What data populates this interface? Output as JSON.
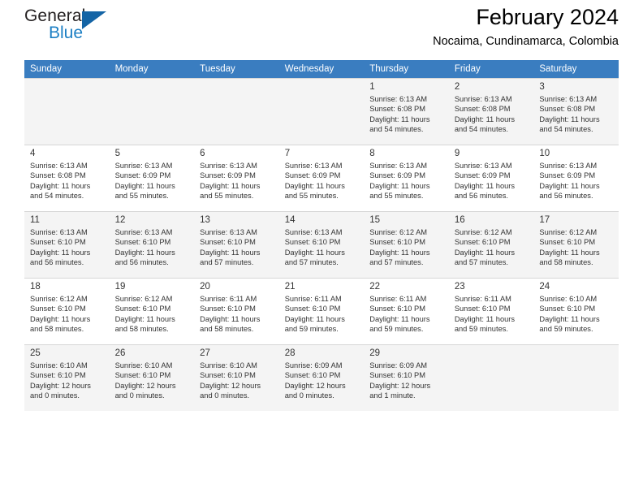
{
  "logo": {
    "word_top": "General",
    "word_bottom": "Blue",
    "triangle_color": "#1464a5",
    "blue_color": "#1c7fc4"
  },
  "header": {
    "title": "February 2024",
    "subtitle": "Nocaima, Cundinamarca, Colombia"
  },
  "theme": {
    "header_row_bg": "#3a7dc0",
    "header_row_text": "#ffffff",
    "shaded_row_bg": "#f4f4f4",
    "grid_line": "#d6d6d6",
    "text": "#333333"
  },
  "weekdays": [
    "Sunday",
    "Monday",
    "Tuesday",
    "Wednesday",
    "Thursday",
    "Friday",
    "Saturday"
  ],
  "labels": {
    "sunrise": "Sunrise:",
    "sunset": "Sunset:",
    "daylight": "Daylight:"
  },
  "weeks": [
    {
      "shaded": true,
      "days": [
        {
          "empty": true
        },
        {
          "empty": true
        },
        {
          "empty": true
        },
        {
          "empty": true
        },
        {
          "day": "1",
          "sunrise": "Sunrise: 6:13 AM",
          "sunset": "Sunset: 6:08 PM",
          "daylight_1": "Daylight: 11 hours",
          "daylight_2": "and 54 minutes."
        },
        {
          "day": "2",
          "sunrise": "Sunrise: 6:13 AM",
          "sunset": "Sunset: 6:08 PM",
          "daylight_1": "Daylight: 11 hours",
          "daylight_2": "and 54 minutes."
        },
        {
          "day": "3",
          "sunrise": "Sunrise: 6:13 AM",
          "sunset": "Sunset: 6:08 PM",
          "daylight_1": "Daylight: 11 hours",
          "daylight_2": "and 54 minutes."
        }
      ]
    },
    {
      "shaded": false,
      "days": [
        {
          "day": "4",
          "sunrise": "Sunrise: 6:13 AM",
          "sunset": "Sunset: 6:08 PM",
          "daylight_1": "Daylight: 11 hours",
          "daylight_2": "and 54 minutes."
        },
        {
          "day": "5",
          "sunrise": "Sunrise: 6:13 AM",
          "sunset": "Sunset: 6:09 PM",
          "daylight_1": "Daylight: 11 hours",
          "daylight_2": "and 55 minutes."
        },
        {
          "day": "6",
          "sunrise": "Sunrise: 6:13 AM",
          "sunset": "Sunset: 6:09 PM",
          "daylight_1": "Daylight: 11 hours",
          "daylight_2": "and 55 minutes."
        },
        {
          "day": "7",
          "sunrise": "Sunrise: 6:13 AM",
          "sunset": "Sunset: 6:09 PM",
          "daylight_1": "Daylight: 11 hours",
          "daylight_2": "and 55 minutes."
        },
        {
          "day": "8",
          "sunrise": "Sunrise: 6:13 AM",
          "sunset": "Sunset: 6:09 PM",
          "daylight_1": "Daylight: 11 hours",
          "daylight_2": "and 55 minutes."
        },
        {
          "day": "9",
          "sunrise": "Sunrise: 6:13 AM",
          "sunset": "Sunset: 6:09 PM",
          "daylight_1": "Daylight: 11 hours",
          "daylight_2": "and 56 minutes."
        },
        {
          "day": "10",
          "sunrise": "Sunrise: 6:13 AM",
          "sunset": "Sunset: 6:09 PM",
          "daylight_1": "Daylight: 11 hours",
          "daylight_2": "and 56 minutes."
        }
      ]
    },
    {
      "shaded": true,
      "days": [
        {
          "day": "11",
          "sunrise": "Sunrise: 6:13 AM",
          "sunset": "Sunset: 6:10 PM",
          "daylight_1": "Daylight: 11 hours",
          "daylight_2": "and 56 minutes."
        },
        {
          "day": "12",
          "sunrise": "Sunrise: 6:13 AM",
          "sunset": "Sunset: 6:10 PM",
          "daylight_1": "Daylight: 11 hours",
          "daylight_2": "and 56 minutes."
        },
        {
          "day": "13",
          "sunrise": "Sunrise: 6:13 AM",
          "sunset": "Sunset: 6:10 PM",
          "daylight_1": "Daylight: 11 hours",
          "daylight_2": "and 57 minutes."
        },
        {
          "day": "14",
          "sunrise": "Sunrise: 6:13 AM",
          "sunset": "Sunset: 6:10 PM",
          "daylight_1": "Daylight: 11 hours",
          "daylight_2": "and 57 minutes."
        },
        {
          "day": "15",
          "sunrise": "Sunrise: 6:12 AM",
          "sunset": "Sunset: 6:10 PM",
          "daylight_1": "Daylight: 11 hours",
          "daylight_2": "and 57 minutes."
        },
        {
          "day": "16",
          "sunrise": "Sunrise: 6:12 AM",
          "sunset": "Sunset: 6:10 PM",
          "daylight_1": "Daylight: 11 hours",
          "daylight_2": "and 57 minutes."
        },
        {
          "day": "17",
          "sunrise": "Sunrise: 6:12 AM",
          "sunset": "Sunset: 6:10 PM",
          "daylight_1": "Daylight: 11 hours",
          "daylight_2": "and 58 minutes."
        }
      ]
    },
    {
      "shaded": false,
      "days": [
        {
          "day": "18",
          "sunrise": "Sunrise: 6:12 AM",
          "sunset": "Sunset: 6:10 PM",
          "daylight_1": "Daylight: 11 hours",
          "daylight_2": "and 58 minutes."
        },
        {
          "day": "19",
          "sunrise": "Sunrise: 6:12 AM",
          "sunset": "Sunset: 6:10 PM",
          "daylight_1": "Daylight: 11 hours",
          "daylight_2": "and 58 minutes."
        },
        {
          "day": "20",
          "sunrise": "Sunrise: 6:11 AM",
          "sunset": "Sunset: 6:10 PM",
          "daylight_1": "Daylight: 11 hours",
          "daylight_2": "and 58 minutes."
        },
        {
          "day": "21",
          "sunrise": "Sunrise: 6:11 AM",
          "sunset": "Sunset: 6:10 PM",
          "daylight_1": "Daylight: 11 hours",
          "daylight_2": "and 59 minutes."
        },
        {
          "day": "22",
          "sunrise": "Sunrise: 6:11 AM",
          "sunset": "Sunset: 6:10 PM",
          "daylight_1": "Daylight: 11 hours",
          "daylight_2": "and 59 minutes."
        },
        {
          "day": "23",
          "sunrise": "Sunrise: 6:11 AM",
          "sunset": "Sunset: 6:10 PM",
          "daylight_1": "Daylight: 11 hours",
          "daylight_2": "and 59 minutes."
        },
        {
          "day": "24",
          "sunrise": "Sunrise: 6:10 AM",
          "sunset": "Sunset: 6:10 PM",
          "daylight_1": "Daylight: 11 hours",
          "daylight_2": "and 59 minutes."
        }
      ]
    },
    {
      "shaded": true,
      "days": [
        {
          "day": "25",
          "sunrise": "Sunrise: 6:10 AM",
          "sunset": "Sunset: 6:10 PM",
          "daylight_1": "Daylight: 12 hours",
          "daylight_2": "and 0 minutes."
        },
        {
          "day": "26",
          "sunrise": "Sunrise: 6:10 AM",
          "sunset": "Sunset: 6:10 PM",
          "daylight_1": "Daylight: 12 hours",
          "daylight_2": "and 0 minutes."
        },
        {
          "day": "27",
          "sunrise": "Sunrise: 6:10 AM",
          "sunset": "Sunset: 6:10 PM",
          "daylight_1": "Daylight: 12 hours",
          "daylight_2": "and 0 minutes."
        },
        {
          "day": "28",
          "sunrise": "Sunrise: 6:09 AM",
          "sunset": "Sunset: 6:10 PM",
          "daylight_1": "Daylight: 12 hours",
          "daylight_2": "and 0 minutes."
        },
        {
          "day": "29",
          "sunrise": "Sunrise: 6:09 AM",
          "sunset": "Sunset: 6:10 PM",
          "daylight_1": "Daylight: 12 hours",
          "daylight_2": "and 1 minute."
        },
        {
          "empty": true
        },
        {
          "empty": true
        }
      ]
    }
  ]
}
